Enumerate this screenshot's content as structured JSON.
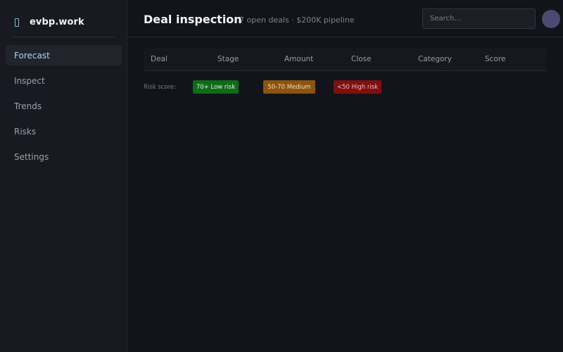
{
  "brand": {
    "name": "evbp.work"
  },
  "sidebar": {
    "items": [
      {
        "label": "Forecast",
        "active": true
      },
      {
        "label": "Inspect",
        "active": false
      },
      {
        "label": "Trends",
        "active": false
      },
      {
        "label": "Risks",
        "active": false
      },
      {
        "label": "Settings",
        "active": false
      }
    ]
  },
  "header": {
    "title": "Deal inspection",
    "subtitle": "7 open deals · $200K pipeline",
    "search_placeholder": "Search..."
  },
  "table": {
    "columns": [
      "Deal",
      "Stage",
      "Amount",
      "Close",
      "Category",
      "Score"
    ],
    "rows": []
  },
  "legend": {
    "label": "Risk score:",
    "items": [
      {
        "label": "70+ Low risk",
        "bg": "#0f6a1b",
        "fg": "#d6f5d9"
      },
      {
        "label": "50-70 Medium",
        "bg": "#8a5510",
        "fg": "#f8dfb5"
      },
      {
        "label": "<50 High risk",
        "bg": "#7d1010",
        "fg": "#f4bdbd"
      }
    ]
  },
  "colors": {
    "background": "#131419",
    "sidebar": "#191a21",
    "accent": "#6cc0e6"
  }
}
